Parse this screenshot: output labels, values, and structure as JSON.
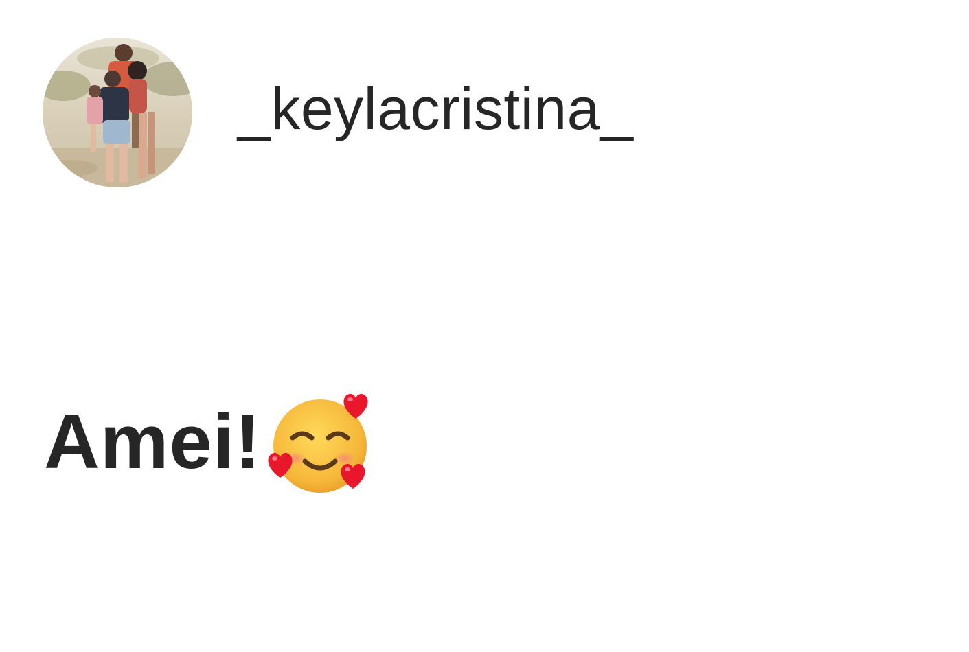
{
  "comment": {
    "username": "_keylacristina_",
    "text": "Amei!",
    "emoji": "smiling-face-with-hearts-icon"
  },
  "avatar": {
    "icon": "profile-photo-avatar"
  },
  "colors": {
    "text": "#262626",
    "background": "#ffffff",
    "emoji_face": "#f5b731",
    "heart": "#e8172c"
  }
}
